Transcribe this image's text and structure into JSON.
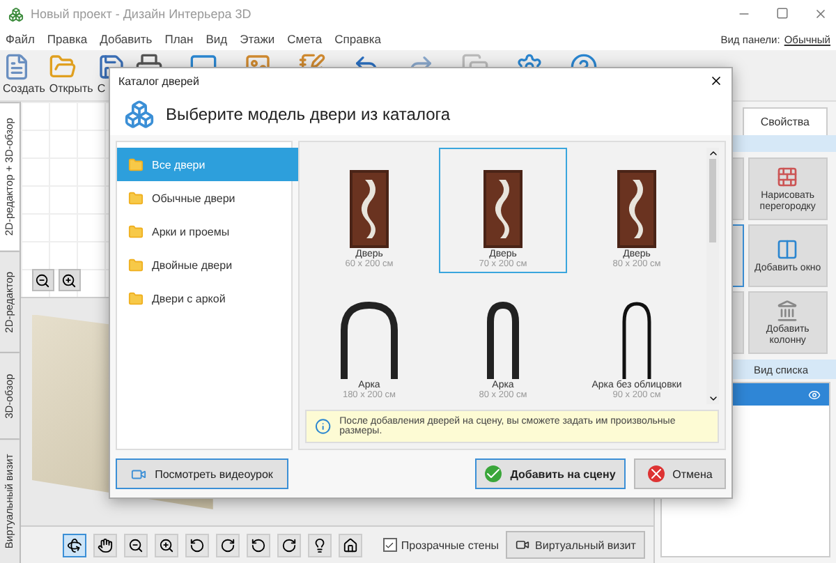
{
  "window": {
    "title": "Новый проект - Дизайн Интерьера 3D"
  },
  "menu": [
    "Файл",
    "Правка",
    "Добавить",
    "План",
    "Вид",
    "Этажи",
    "Смета",
    "Справка"
  ],
  "toolbar_labels": [
    "Создать",
    "Открыть",
    "С"
  ],
  "panel_view": {
    "label": "Вид панели:",
    "value": "Обычный"
  },
  "side_tabs": [
    {
      "label": "2D-редактор + 3D-обзор",
      "selected": true
    },
    {
      "label": "2D-редактор",
      "selected": false
    },
    {
      "label": "3D-обзор",
      "selected": false
    },
    {
      "label": "Виртуальный визит",
      "selected": false
    }
  ],
  "right_panel": {
    "tab": "Свойства",
    "hidden_tools": [
      {
        "selected": false
      },
      {
        "selected": true
      },
      {
        "selected": false
      }
    ],
    "tools": [
      {
        "kind": "wall",
        "label": "Нарисовать перегородку"
      },
      {
        "kind": "window",
        "label": "Добавить окно"
      },
      {
        "kind": "column",
        "label": "Добавить колонну"
      }
    ],
    "list_header": "Вид списка",
    "list_rows": [
      {
        "selected": true
      }
    ]
  },
  "bottom_bar": {
    "transparent_walls": {
      "label": "Прозрачные стены",
      "checked": true
    },
    "visit_button": "Виртуальный визит"
  },
  "dialog": {
    "title": "Каталог дверей",
    "heading": "Выберите модель двери из каталога",
    "categories": [
      {
        "label": "Все двери",
        "selected": true
      },
      {
        "label": "Обычные двери",
        "selected": false
      },
      {
        "label": "Арки и проемы",
        "selected": false
      },
      {
        "label": "Двойные двери",
        "selected": false
      },
      {
        "label": "Двери с аркой",
        "selected": false
      }
    ],
    "items": [
      {
        "kind": "door",
        "name": "Дверь",
        "size": "60 x 200 см",
        "selected": false
      },
      {
        "kind": "door",
        "name": "Дверь",
        "size": "70 x 200 см",
        "selected": true
      },
      {
        "kind": "door",
        "name": "Дверь",
        "size": "80 x 200 см",
        "selected": false
      },
      {
        "kind": "wide_arch",
        "name": "Арка",
        "size": "180 x 200 см",
        "selected": false
      },
      {
        "kind": "arch",
        "name": "Арка",
        "size": "80 x 200 см",
        "selected": false
      },
      {
        "kind": "plain_arch",
        "name": "Арка без облицовки",
        "size": "90 x 200 см",
        "selected": false
      }
    ],
    "info": "После добавления дверей на сцену, вы сможете задать им произвольные размеры.",
    "video_button": "Посмотреть видеоурок",
    "add_button": "Добавить на сцену",
    "cancel_button": "Отмена"
  }
}
